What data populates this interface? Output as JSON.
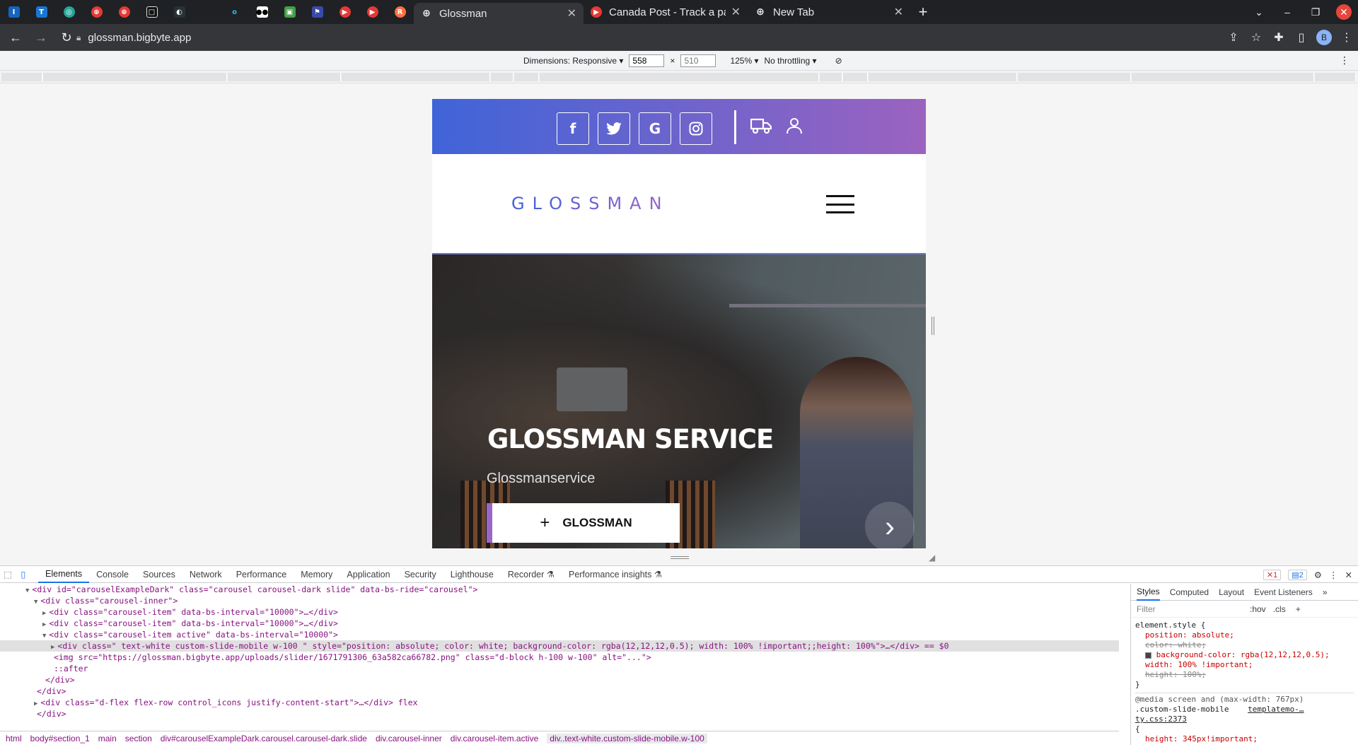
{
  "browser": {
    "tabs": [
      {
        "title": "Glossman",
        "active": true
      },
      {
        "title": "Canada Post - Track a pack",
        "active": false
      },
      {
        "title": "New Tab",
        "active": false
      }
    ],
    "url": "glossman.bigbyte.app",
    "avatar_letter": "B"
  },
  "device_toolbar": {
    "dimensions_label": "Dimensions: Responsive",
    "width": "558",
    "height_placeholder": "510",
    "times": "×",
    "zoom": "125%",
    "throttling": "No throttling"
  },
  "site": {
    "logo_text": "GLOSSMAN",
    "social": [
      "f",
      "t",
      "G",
      "ig"
    ],
    "slide_title": "GLOSSMAN SERVICE",
    "slide_subtitle": "Glossmanservice",
    "slide_button": "GLOSSMAN",
    "brand_gradient": [
      "#3f64d8",
      "#9b63c0"
    ]
  },
  "devtools": {
    "tabs": [
      "Elements",
      "Console",
      "Sources",
      "Network",
      "Performance",
      "Memory",
      "Application",
      "Security",
      "Lighthouse",
      "Recorder ⚗",
      "Performance insights ⚗"
    ],
    "error_count": "1",
    "message_count": "2",
    "code_lines": [
      {
        "indent": 4,
        "arrow": "▼",
        "html": "<div id=\"carouselExampleDark\" class=\"carousel carousel-dark slide\" data-bs-ride=\"carousel\">"
      },
      {
        "indent": 6,
        "arrow": "▼",
        "html": "<div class=\"carousel-inner\">"
      },
      {
        "indent": 8,
        "arrow": "▶",
        "html": "<div class=\"carousel-item\" data-bs-interval=\"10000\">…</div>"
      },
      {
        "indent": 8,
        "arrow": "▶",
        "html": "<div class=\"carousel-item\" data-bs-interval=\"10000\">…</div>"
      },
      {
        "indent": 8,
        "arrow": "▼",
        "html": "<div class=\"carousel-item active\" data-bs-interval=\"10000\">"
      },
      {
        "indent": 10,
        "arrow": "▶",
        "html": "<div class=\" text-white custom-slide-mobile w-100 \" style=\"position: absolute; color: white; background-color: rgba(12,12,12,0.5);  width: 100% !important;;height: 100%\">…</div> == $0",
        "selected": true
      },
      {
        "indent": 10,
        "arrow": "",
        "html": "<img src=\"https://glossman.bigbyte.app/uploads/slider/1671791306_63a582ca66782.png\" class=\"d-block h-100 w-100\" alt=\"...\">"
      },
      {
        "indent": 10,
        "arrow": "",
        "html": "::after"
      },
      {
        "indent": 8,
        "arrow": "",
        "html": "</div>"
      },
      {
        "indent": 6,
        "arrow": "",
        "html": "</div>"
      },
      {
        "indent": 6,
        "arrow": "▶",
        "html": "<div class=\"d-flex flex-row control_icons justify-content-start\">…</div> flex"
      },
      {
        "indent": 6,
        "arrow": "",
        "html": "</div>"
      }
    ],
    "breadcrumbs": [
      "html",
      "body#section_1",
      "main",
      "section",
      "div#carouselExampleDark.carousel.carousel-dark.slide",
      "div.carousel-inner",
      "div.carousel-item.active",
      "div..text-white.custom-slide-mobile.w-100"
    ],
    "styles_tabs": [
      "Styles",
      "Computed",
      "Layout",
      "Event Listeners",
      "»"
    ],
    "filter_placeholder": "Filter",
    "hov": ":hov",
    "cls": ".cls",
    "rules": {
      "element_style": "element.style {",
      "props": [
        "position: absolute;",
        "color: white;",
        "background-color: rgba(12,12,12,0.5);",
        "width: 100% !important;",
        "height: 100%;"
      ],
      "close": "}",
      "media": "@media screen and (max-width: 767px)",
      "selector": ".custom-slide-mobile",
      "source": "templatemo-…ty.css:2373",
      "open": "{",
      "height_rule": "height: 345px!important;"
    }
  }
}
